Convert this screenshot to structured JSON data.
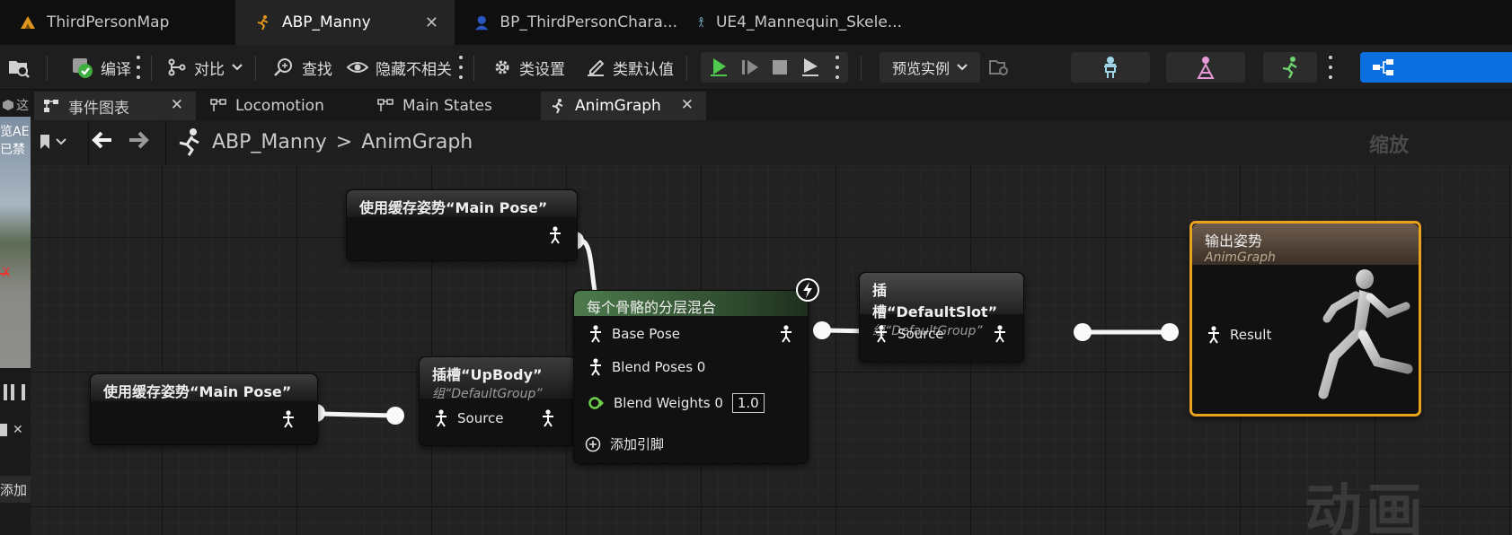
{
  "doc_tabs": [
    {
      "label": "ThirdPersonMap",
      "icon": "level-icon",
      "active": false
    },
    {
      "label": "ABP_Manny",
      "icon": "anim-blueprint-icon",
      "active": true
    },
    {
      "label": "BP_ThirdPersonChara...",
      "icon": "character-blueprint-icon",
      "active": false
    },
    {
      "label": "UE4_Mannequin_Skele...",
      "icon": "skeleton-icon",
      "active": false
    }
  ],
  "toolbar": {
    "compile_label": "编译",
    "diff_label": "对比",
    "find_label": "查找",
    "hide_unrelated_label": "隐藏不相关",
    "class_settings_label": "类设置",
    "class_defaults_label": "类默认值",
    "preview_instance_label": "预览实例"
  },
  "graph_tabs": [
    {
      "label": "事件图表",
      "closable": true
    },
    {
      "label": "Locomotion",
      "closable": false
    },
    {
      "label": "Main States",
      "closable": false
    },
    {
      "label": "AnimGraph",
      "closable": true,
      "active": true
    }
  ],
  "breadcrumb": {
    "root": "ABP_Manny",
    "separator": ">",
    "current": "AnimGraph",
    "zoom_text": "缩放"
  },
  "watermark": "动画",
  "left_panel_fragments": [
    "览AE",
    "已禁",
    "X"
  ],
  "bottom_left_label": "添加",
  "nodes": {
    "cached_pose_top": {
      "title": "使用缓存姿势“Main Pose”"
    },
    "cached_pose_bottom": {
      "title": "使用缓存姿势“Main Pose”"
    },
    "slot_upbody": {
      "title": "插槽“UpBody”",
      "subtitle": "组“DefaultGroup”",
      "pin_source": "Source"
    },
    "layered_blend": {
      "title": "每个骨骼的分层混合",
      "pin_base": "Base Pose",
      "pin_blend_poses": "Blend Poses 0",
      "pin_blend_weights": "Blend Weights 0",
      "blend_weight_value": "1.0",
      "add_pin": "添加引脚"
    },
    "slot_default": {
      "title": "插槽“DefaultSlot”",
      "subtitle": "组“DefaultGroup”",
      "pin_source": "Source"
    },
    "output_pose": {
      "title": "输出姿势",
      "subtitle": "AnimGraph",
      "pin_result": "Result"
    }
  },
  "colors": {
    "accent_blue": "#0b6fe0",
    "output_border": "#e8a21c",
    "blend_header": "#4d7a4d",
    "wire": "#f4f4f4",
    "play_green": "#4ec94e"
  }
}
